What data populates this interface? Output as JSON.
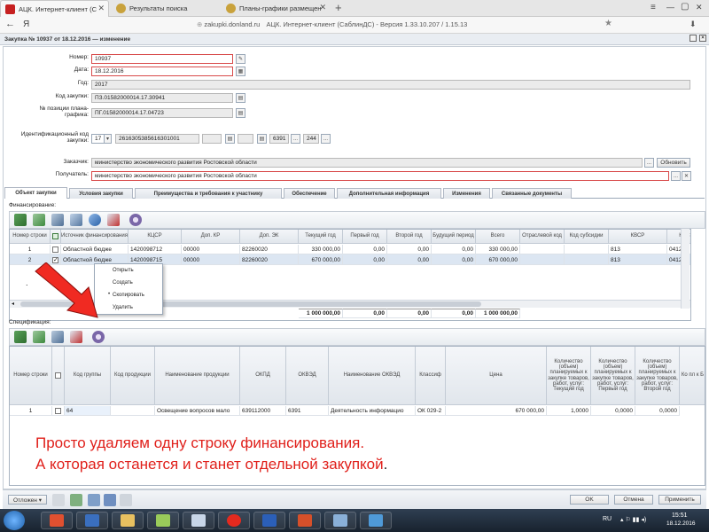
{
  "browser": {
    "tabs": [
      {
        "title": "АЦК. Интернет-клиент (С"
      },
      {
        "title": "Результаты поиска"
      },
      {
        "title": "Планы-графики размещен"
      }
    ],
    "new_tab_symbol": "+",
    "back_symbol": "←",
    "yandex_logo": "Я",
    "url_domain": "zakupki.donland.ru",
    "page_title": "АЦК. Интернет-клиент (СаблинДС) - Версия 1.33.10.207 / 1.15.13",
    "window_controls": {
      "menu": "≡",
      "minimize": "—",
      "maximize": "▢",
      "close": "✕"
    }
  },
  "form": {
    "title": "Закупка № 10937 от 18.12.2016 — изменение",
    "fields": {
      "number": {
        "label": "Номер:",
        "value": "10937"
      },
      "date": {
        "label": "Дата:",
        "value": "18.12.2016"
      },
      "year": {
        "label": "Год:",
        "value": "2017"
      },
      "purchase_code": {
        "label": "Код закупки:",
        "value": "ПЗ.01582000014.17.30941"
      },
      "plan_position": {
        "label": "№ позиции плана-графика:",
        "value": "ПГ.01582000014.17.04723"
      },
      "ident_code": {
        "label": "Идентификационный код закупки:",
        "year_part": "17",
        "main_part": "2616305385616301001",
        "part2": "6391",
        "part3": "244"
      },
      "customer": {
        "label": "Заказчик:",
        "value": "министерство экономического развития Ростовской области",
        "refresh_label": "Обновить"
      },
      "recipient": {
        "label": "Получатель:",
        "value": "министерство экономического развития Ростовской области"
      }
    },
    "tabs": [
      {
        "label": "Объект закупки",
        "active": true
      },
      {
        "label": "Условия закупки"
      },
      {
        "label": "Преимущества и требования к участнику"
      },
      {
        "label": "Обеспечение"
      },
      {
        "label": "Дополнительная информация"
      },
      {
        "label": "Изменения"
      },
      {
        "label": "Связанные документы"
      }
    ],
    "ellipsis": "..."
  },
  "financing": {
    "section_label": "Финансирование:",
    "columns": [
      "Номер строки",
      "Источник финансирования",
      "КЦСР",
      "Доп. КР",
      "Доп. ЭК",
      "Текущий год",
      "Первый год",
      "Второй год",
      "Будущий период",
      "Всего",
      "Отраслевой код",
      "Код субсидии",
      "КВСР",
      "КОС"
    ],
    "rows": [
      {
        "num": "1",
        "source": "Областной бюдже",
        "kcsr": "1420098712",
        "dop_kr": "00000",
        "dop_ek": "82260020",
        "cur": "330 000,00",
        "y1": "0,00",
        "y2": "0,00",
        "fut": "0,00",
        "total": "330 000,00",
        "otr": "",
        "sub": "",
        "kvsr": "813",
        "kosgu": "0412"
      },
      {
        "num": "2",
        "source": "Областной бюдже",
        "kcsr": "1420098715",
        "dop_kr": "00000",
        "dop_ek": "82260020",
        "cur": "670 000,00",
        "y1": "0,00",
        "y2": "0,00",
        "fut": "0,00",
        "total": "670 000,00",
        "otr": "",
        "sub": "",
        "kvsr": "813",
        "kosgu": "0412"
      }
    ],
    "totals": {
      "cur": "1 000 000,00",
      "y1": "0,00",
      "y2": "0,00",
      "fut": "0,00",
      "total": "1 000 000,00"
    },
    "dot": "."
  },
  "context_menu": {
    "items": [
      {
        "label": "Открыть"
      },
      {
        "label": "Создать"
      },
      {
        "label": "Скопировать",
        "bullet": "•"
      },
      {
        "label": "Удалить"
      }
    ]
  },
  "specification": {
    "section_label": "Спецификация:",
    "columns": [
      "Номер строки",
      "Код группы",
      "Код продукции",
      "Наименование продукции",
      "ОКПД",
      "ОКВЭД",
      "Наименование ОКВЭД",
      "Классиф",
      "Цена",
      "Количество (объем) планируемых к закупке товаров, работ, услуг: Текущий год",
      "Количество (объем) планируемых к закупке товаров, работ, услуг: Первый год",
      "Количество (объем) планируемых к закупке товаров, работ, услуг: Второй год",
      "Ко пл к Б"
    ],
    "rows": [
      {
        "num": "1",
        "group": "64",
        "prod_code": "",
        "prod_name": "Освещение вопросов мало",
        "okpd": "639112000",
        "okved": "6391",
        "okved_name": "Деятельность информацио",
        "classif": "ОК 029-2",
        "price": "670 000,00",
        "q_cur": "1,0000",
        "q_y1": "0,0000",
        "q_y2": "0,0000"
      }
    ]
  },
  "annotation": {
    "line1": "Просто удаляем одну строку финансирования.",
    "line2": "А которая останется и станет отдельной закупкой",
    "line2_end": ".",
    "color": "#e0201b"
  },
  "footer": {
    "postpone_label": "Отложен ▾",
    "ok_label": "OK",
    "cancel_label": "Отмена",
    "apply_label": "Применить"
  },
  "taskbar": {
    "lang": "RU",
    "time": "15:51",
    "date": "18.12.2016"
  }
}
